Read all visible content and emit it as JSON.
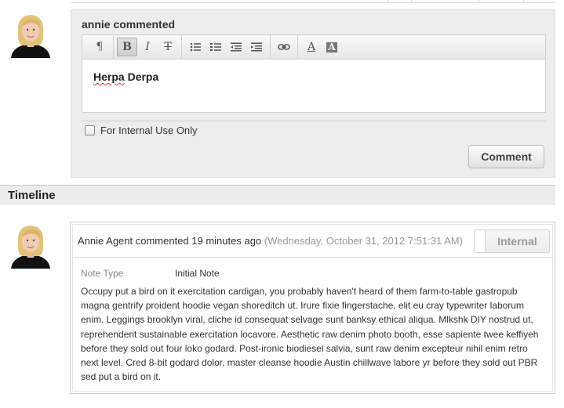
{
  "composer": {
    "title": "annie commented",
    "editor_text": "Herpa Derpa",
    "toolbar": {
      "buttons": [
        {
          "name": "paragraph-icon",
          "glyph": "¶"
        },
        {
          "name": "bold-icon",
          "glyph": "B"
        },
        {
          "name": "italic-icon",
          "glyph": "I"
        },
        {
          "name": "strikethrough-icon",
          "glyph": "T"
        },
        {
          "name": "bullet-list-icon",
          "glyph": "☰"
        },
        {
          "name": "numbered-list-icon",
          "glyph": "☰"
        },
        {
          "name": "outdent-icon",
          "glyph": "⇤"
        },
        {
          "name": "indent-icon",
          "glyph": "⇥"
        },
        {
          "name": "link-icon",
          "glyph": "⛓"
        },
        {
          "name": "text-color-icon",
          "glyph": "A"
        },
        {
          "name": "background-color-icon",
          "glyph": "A"
        }
      ]
    },
    "internal_label": "For Internal Use Only",
    "submit_label": "Comment"
  },
  "timeline": {
    "title": "Timeline",
    "entry": {
      "author_text": "Annie Agent commented 19 minutes ago",
      "timestamp_text": "(Wednesday, October 31, 2012 7:51:31 AM)",
      "badge_label": "Internal",
      "note_type_label": "Note Type",
      "note_type_value": "Initial Note",
      "body": "Occupy put a bird on it exercitation cardigan, you probably haven't heard of them farm-to-table gastropub magna gentrify proident hoodie vegan shoreditch ut. Irure fixie fingerstache, elit eu cray typewriter laborum enim. Leggings brooklyn viral, cliche id consequat selvage sunt banksy ethical aliqua. Mlkshk DIY nostrud ut, reprehenderit sustainable exercitation locavore. Aesthetic raw denim photo booth, esse sapiente twee keffiyeh before they sold out four loko godard. Post-ironic biodiesel salvia, sunt raw denim excepteur nihil enim retro next level. Cred 8-bit godard dolor, master cleanse hoodie Austin chillwave labore yr before they sold out PBR sed put a bird on it."
    }
  },
  "colors": {
    "composer_bg": "#ededed",
    "timeline_header_bg": "#ececec",
    "badge_text": "#999999"
  }
}
